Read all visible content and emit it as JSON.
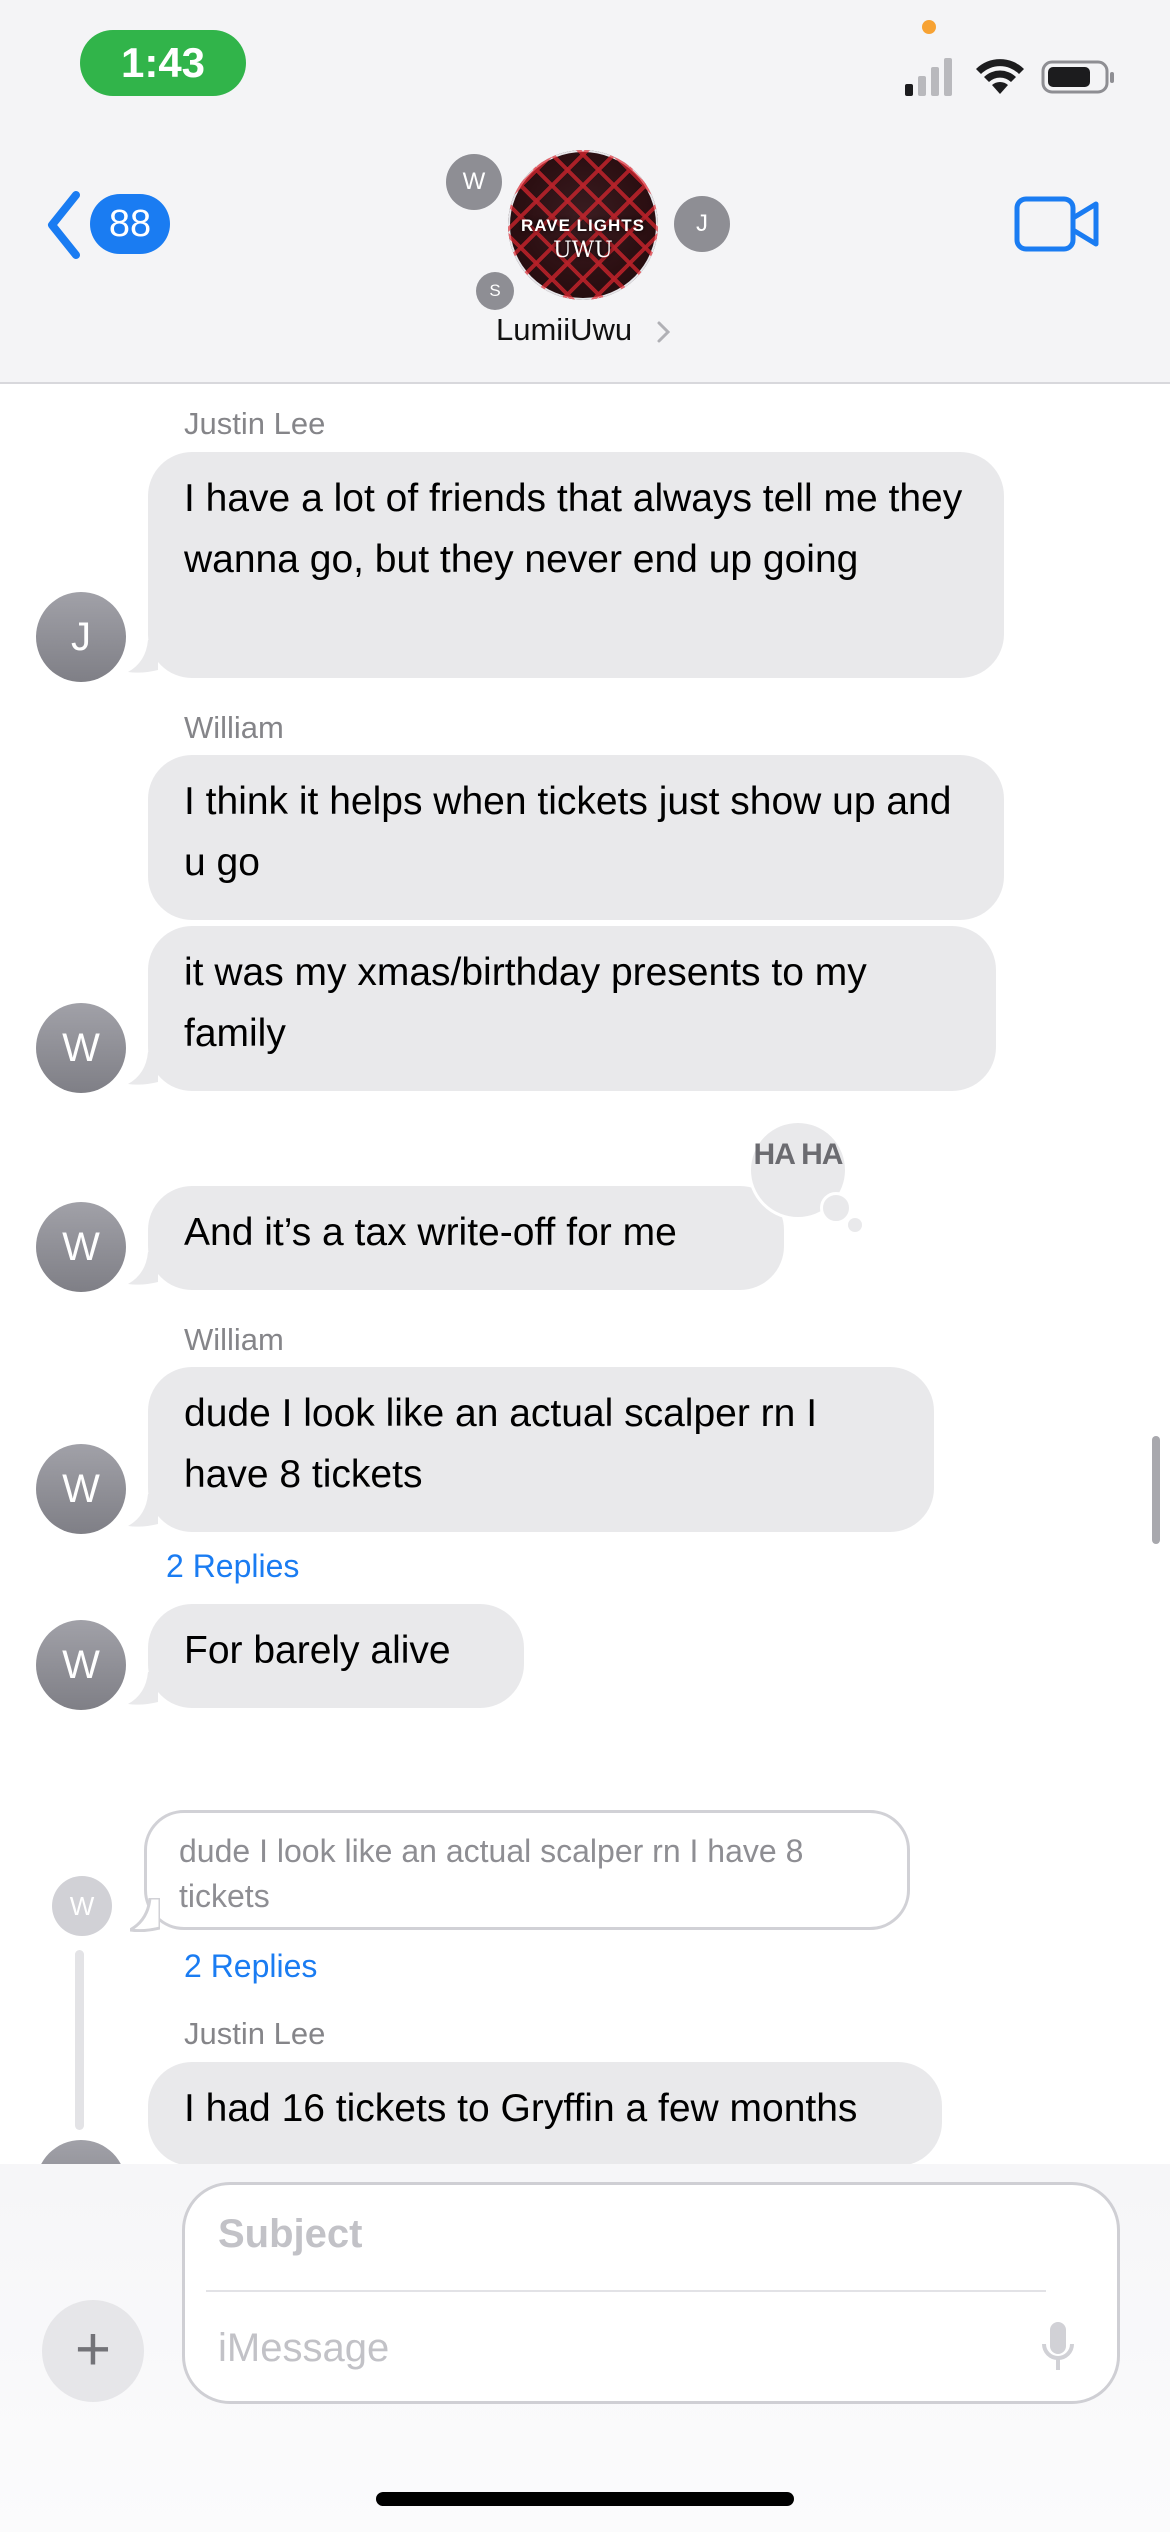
{
  "status_bar": {
    "time": "1:43"
  },
  "header": {
    "back_count": "88",
    "contact_name": "LumiiUwu",
    "group_avatar_line1": "RAVE LIGHTS",
    "group_avatar_line2": "UWU",
    "member_initials": [
      "W",
      "J",
      "S"
    ]
  },
  "messages": [
    {
      "sender": "Justin Lee",
      "text": "I have a lot of friends that always tell me they wanna go, but they never end up going",
      "avatar": "J"
    },
    {
      "sender": "William",
      "text": "I think it helps when tickets just show up and u go"
    },
    {
      "text": "it was my xmas/birthday presents to my family",
      "avatar": "W"
    },
    {
      "text": "And it’s a tax write-off for me",
      "avatar": "W",
      "tapback": "HA HA"
    },
    {
      "sender": "William",
      "text": "dude I look like an actual scalper rn I have 8 tickets",
      "avatar": "W",
      "replies": "2 Replies"
    },
    {
      "text": "For barely alive",
      "avatar": "W"
    }
  ],
  "thread": {
    "quoted": "dude I look like an actual scalper rn I have 8 tickets",
    "quoted_avatar": "W",
    "replies": "2 Replies",
    "sender": "Justin Lee",
    "text": "I had 16 tickets to Gryffin a few months"
  },
  "composer": {
    "subject_placeholder": "Subject",
    "message_placeholder": "iMessage",
    "plus": "+"
  }
}
